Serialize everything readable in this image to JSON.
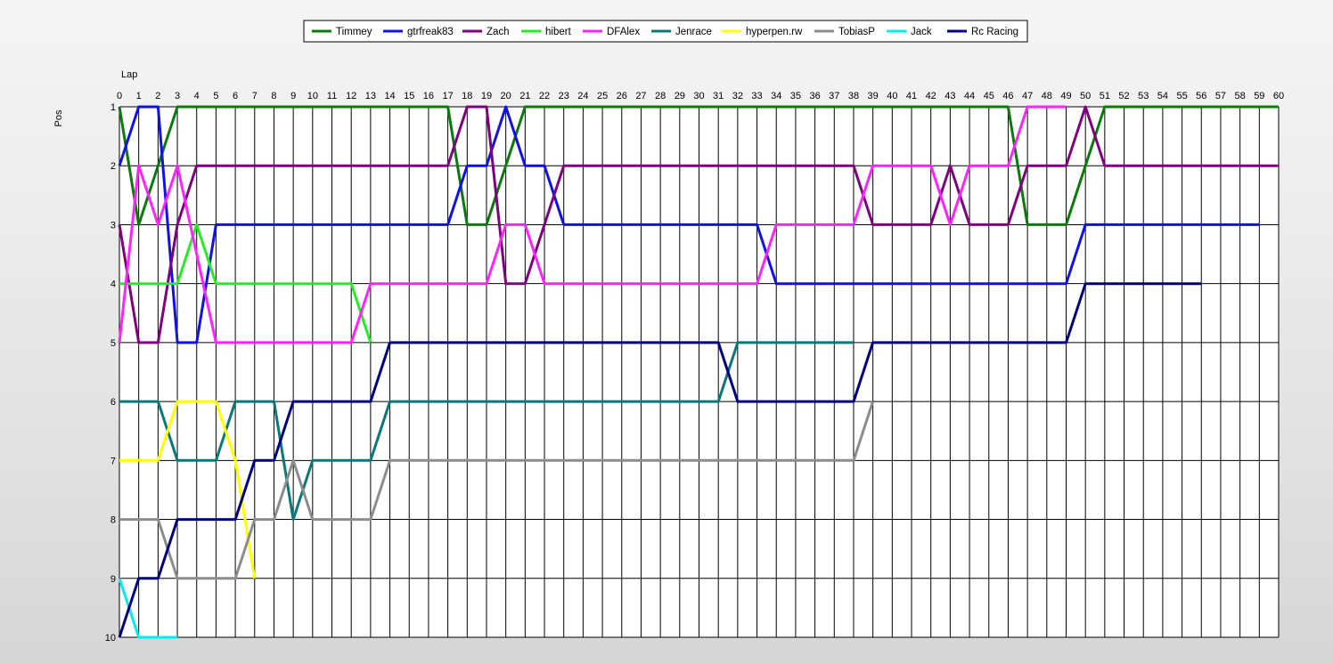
{
  "chart_data": {
    "type": "line",
    "title": "",
    "xlabel": "Lap",
    "ylabel": "Pos",
    "xlim": [
      0,
      60
    ],
    "ylim": [
      1,
      10
    ],
    "y_inverted": true,
    "grid": true,
    "legend_placement": "top-center",
    "x_ticks": [
      "0",
      "1",
      "2",
      "3",
      "4",
      "5",
      "6",
      "7",
      "8",
      "9",
      "10",
      "11",
      "12",
      "13",
      "14",
      "15",
      "16",
      "17",
      "18",
      "19",
      "20",
      "21",
      "22",
      "23",
      "24",
      "25",
      "26",
      "27",
      "28",
      "29",
      "30",
      "31",
      "32",
      "33",
      "34",
      "35",
      "36",
      "37",
      "38",
      "39",
      "40",
      "41",
      "42",
      "43",
      "44",
      "45",
      "46",
      "47",
      "48",
      "49",
      "50",
      "51",
      "52",
      "53",
      "54",
      "55",
      "56",
      "57",
      "58",
      "59",
      "60"
    ],
    "y_ticks": [
      "1",
      "2",
      "3",
      "4",
      "5",
      "6",
      "7",
      "8",
      "9",
      "10"
    ],
    "series": [
      {
        "name": "Timmey",
        "color": "#0a7a0a",
        "points": [
          [
            0,
            1
          ],
          [
            1,
            3
          ],
          [
            3,
            1
          ],
          [
            17,
            1
          ],
          [
            18,
            3
          ],
          [
            19,
            3
          ],
          [
            21,
            1
          ],
          [
            46,
            1
          ],
          [
            47,
            3
          ],
          [
            49,
            3
          ],
          [
            51,
            1
          ],
          [
            60,
            1
          ]
        ]
      },
      {
        "name": "gtrfreak83",
        "color": "#1010ee",
        "points": [
          [
            0,
            2
          ],
          [
            1,
            1
          ],
          [
            2,
            1
          ],
          [
            3,
            5
          ],
          [
            4,
            5
          ],
          [
            5,
            3
          ],
          [
            17,
            3
          ],
          [
            18,
            2
          ],
          [
            19,
            2
          ],
          [
            20,
            1
          ],
          [
            21,
            2
          ],
          [
            22,
            2
          ],
          [
            23,
            3
          ],
          [
            33,
            3
          ],
          [
            34,
            4
          ],
          [
            49,
            4
          ],
          [
            50,
            3
          ],
          [
            59,
            3
          ]
        ]
      },
      {
        "name": "Zach",
        "color": "#800080",
        "points": [
          [
            0,
            3
          ],
          [
            1,
            5
          ],
          [
            2,
            5
          ],
          [
            3,
            3
          ],
          [
            4,
            2
          ],
          [
            17,
            2
          ],
          [
            18,
            1
          ],
          [
            19,
            1
          ],
          [
            20,
            4
          ],
          [
            21,
            4
          ],
          [
            23,
            2
          ],
          [
            38,
            2
          ],
          [
            39,
            3
          ],
          [
            42,
            3
          ],
          [
            43,
            2
          ],
          [
            44,
            3
          ],
          [
            46,
            3
          ],
          [
            47,
            2
          ],
          [
            49,
            2
          ],
          [
            50,
            1
          ],
          [
            51,
            2
          ],
          [
            60,
            2
          ]
        ]
      },
      {
        "name": "hibert",
        "color": "#22ee22",
        "points": [
          [
            0,
            4
          ],
          [
            3,
            4
          ],
          [
            4,
            3
          ],
          [
            5,
            4
          ],
          [
            12,
            4
          ],
          [
            13,
            5
          ]
        ]
      },
      {
        "name": "DFAlex",
        "color": "#ff22ff",
        "points": [
          [
            0,
            5
          ],
          [
            1,
            2
          ],
          [
            2,
            3
          ],
          [
            3,
            2
          ],
          [
            5,
            5
          ],
          [
            12,
            5
          ],
          [
            13,
            4
          ],
          [
            19,
            4
          ],
          [
            20,
            3
          ],
          [
            21,
            3
          ],
          [
            22,
            4
          ],
          [
            33,
            4
          ],
          [
            34,
            3
          ],
          [
            38,
            3
          ],
          [
            39,
            2
          ],
          [
            42,
            2
          ],
          [
            43,
            3
          ],
          [
            44,
            2
          ],
          [
            46,
            2
          ],
          [
            47,
            1
          ],
          [
            49,
            1
          ]
        ]
      },
      {
        "name": "Jenrace",
        "color": "#0a7878",
        "points": [
          [
            0,
            6
          ],
          [
            2,
            6
          ],
          [
            3,
            7
          ],
          [
            5,
            7
          ],
          [
            6,
            6
          ],
          [
            8,
            6
          ],
          [
            9,
            8
          ],
          [
            10,
            7
          ],
          [
            13,
            7
          ],
          [
            14,
            6
          ],
          [
            31,
            6
          ],
          [
            32,
            5
          ],
          [
            38,
            5
          ]
        ]
      },
      {
        "name": "hyperpen.rw",
        "color": "#ffff00",
        "points": [
          [
            0,
            7
          ],
          [
            2,
            7
          ],
          [
            3,
            6
          ],
          [
            5,
            6
          ],
          [
            6,
            7
          ],
          [
            7,
            9
          ]
        ]
      },
      {
        "name": "TobiasP",
        "color": "#8c8c8c",
        "points": [
          [
            0,
            8
          ],
          [
            2,
            8
          ],
          [
            3,
            9
          ],
          [
            6,
            9
          ],
          [
            7,
            8
          ],
          [
            8,
            8
          ],
          [
            9,
            7
          ],
          [
            10,
            8
          ],
          [
            13,
            8
          ],
          [
            14,
            7
          ],
          [
            38,
            7
          ],
          [
            39,
            6
          ]
        ]
      },
      {
        "name": "Jack",
        "color": "#00eeee",
        "points": [
          [
            0,
            9
          ],
          [
            1,
            10
          ],
          [
            3,
            10
          ]
        ]
      },
      {
        "name": "Rc Racing",
        "color": "#000080",
        "points": [
          [
            0,
            10
          ],
          [
            1,
            9
          ],
          [
            2,
            9
          ],
          [
            3,
            8
          ],
          [
            6,
            8
          ],
          [
            7,
            7
          ],
          [
            8,
            7
          ],
          [
            9,
            6
          ],
          [
            13,
            6
          ],
          [
            14,
            5
          ],
          [
            31,
            5
          ],
          [
            32,
            6
          ],
          [
            38,
            6
          ],
          [
            39,
            5
          ],
          [
            49,
            5
          ],
          [
            50,
            4
          ],
          [
            56,
            4
          ]
        ]
      }
    ]
  }
}
